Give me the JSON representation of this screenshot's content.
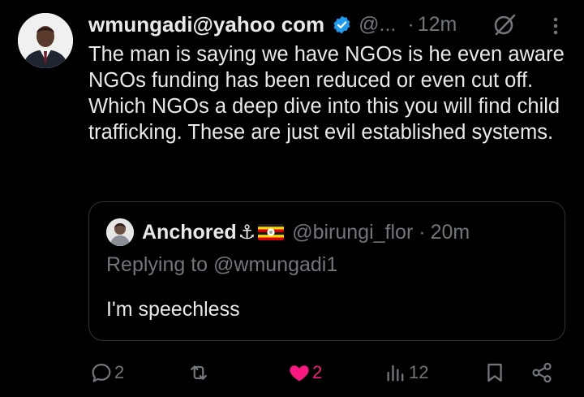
{
  "post": {
    "author_name": "wmungadi@yahoo com",
    "handle": "@...",
    "separator": "·",
    "time": "12m",
    "text": "The man is saying we have NGOs is he even aware NGOs funding has been reduced or even cut off. Which NGOs a deep dive into this you will find child trafficking. These are just evil established systems.",
    "verified": true
  },
  "quote": {
    "author_name": "Anchored",
    "name_emoji": "⚓",
    "flag": "uganda-flag",
    "handle": "@birungi_flor",
    "separator": "·",
    "time": "20m",
    "replying_to": "Replying to @wmungadi1",
    "text": "I'm speechless"
  },
  "actions": {
    "replies": "2",
    "reposts": "",
    "likes": "2",
    "views": "12",
    "liked": true
  },
  "icons": {
    "verified": "verified-badge-icon",
    "grok": "grok-icon",
    "more": "more-vertical-icon",
    "reply": "reply-icon",
    "repost": "repost-icon",
    "like": "heart-icon",
    "views": "views-icon",
    "bookmark": "bookmark-icon",
    "share": "share-icon"
  },
  "colors": {
    "background": "#000000",
    "text": "#e7e9ea",
    "secondary": "#71767b",
    "verified": "#1d9bf0",
    "like": "#f91880",
    "border": "#2f3336"
  }
}
